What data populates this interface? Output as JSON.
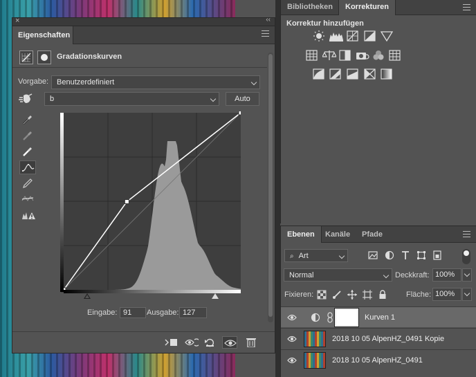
{
  "properties": {
    "tab_label": "Eigenschaften",
    "header_title": "Gradationskurven",
    "preset_label": "Vorgabe:",
    "preset_value": "Benutzerdefiniert",
    "channel_value": "b",
    "auto_label": "Auto",
    "input_label": "Eingabe:",
    "input_value": "91",
    "output_label": "Ausgabe:",
    "output_value": "127"
  },
  "adjustments": {
    "tabs": [
      "Bibliotheken",
      "Korrekturen"
    ],
    "active_tab": "Korrekturen",
    "title": "Korrektur hinzufügen"
  },
  "layers": {
    "tabs": [
      "Ebenen",
      "Kanäle",
      "Pfade"
    ],
    "filter_value": "Art",
    "blend_mode": "Normal",
    "opacity_label": "Deckkraft:",
    "opacity_value": "100%",
    "lock_label": "Fixieren:",
    "fill_label": "Fläche:",
    "fill_value": "100%",
    "items": [
      {
        "name": "Kurven 1",
        "selected": true
      },
      {
        "name": "2018 10 05 AlpenHZ_0491 Kopie",
        "selected": false
      },
      {
        "name": "2018 10 05 AlpenHZ_0491",
        "selected": false
      }
    ]
  },
  "chart_data": {
    "type": "line",
    "x": [
      0,
      91,
      255
    ],
    "y": [
      0,
      127,
      255
    ],
    "xlim": [
      0,
      255
    ],
    "ylim": [
      0,
      255
    ]
  }
}
